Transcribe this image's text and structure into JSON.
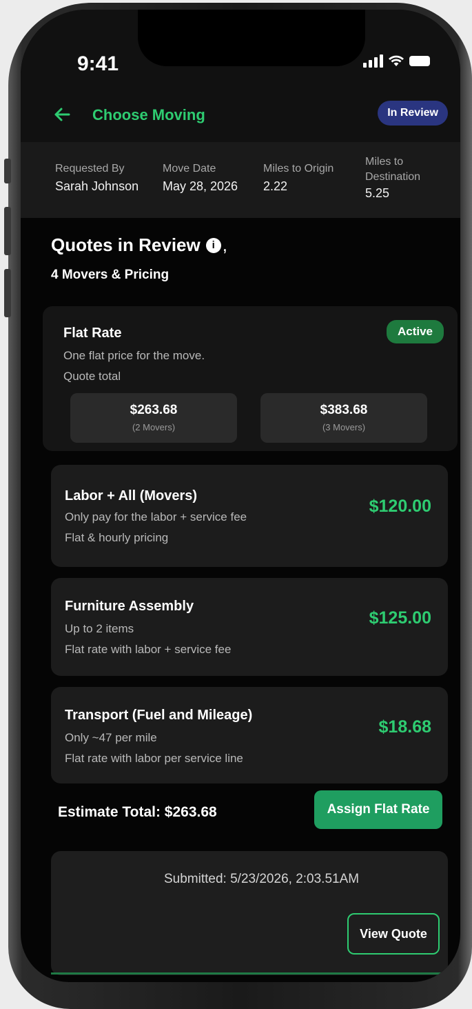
{
  "status_bar": {
    "time": "9:41"
  },
  "header": {
    "back_icon": "arrow-left-icon",
    "title": "Choose Moving",
    "status_badge": "In Review"
  },
  "move_info": [
    {
      "label": "Requested By",
      "value": "Sarah Johnson"
    },
    {
      "label": "Move Date",
      "value": "May 28, 2026"
    },
    {
      "label": "Miles to Origin",
      "value": "2.22"
    },
    {
      "label": "Miles to Destination",
      "value": "5.25"
    }
  ],
  "quotes": {
    "title": "Quotes in Review",
    "title_suffix": ",",
    "subtitle": "4 Movers & Pricing"
  },
  "flat_rate": {
    "title": "Flat Rate",
    "badge": "Active",
    "line1": "One flat price for the move.",
    "line2": "Quote total",
    "options": [
      {
        "amount": "$263.68",
        "sub": "(2 Movers)"
      },
      {
        "amount": "$383.68",
        "sub": "(3 Movers)"
      }
    ]
  },
  "services": [
    {
      "title": "Labor + All (Movers)",
      "line1": "Only pay for the labor + service fee",
      "line2": "Flat & hourly pricing",
      "price": "$120.00"
    },
    {
      "title": "Furniture Assembly",
      "line1": "Up to 2 items",
      "line2": "Flat rate with labor + service fee",
      "price": "$125.00"
    },
    {
      "title": "Transport (Fuel and Mileage)",
      "line1": "Only ~47 per mile",
      "line2": "Flat rate with labor per service line",
      "price": "$18.68"
    }
  ],
  "footer": {
    "estimate_total": "Estimate Total: $263.68",
    "assign_button": "Assign Flat Rate",
    "submitted": "Submitted: 5/23/2026, 2:03.51AM",
    "view_quote_button": "View Quote"
  },
  "colors": {
    "accent_green": "#2ecc71",
    "badge_blue": "#2a3580",
    "active_green": "#1e7a3e",
    "button_green": "#1f9e60"
  }
}
